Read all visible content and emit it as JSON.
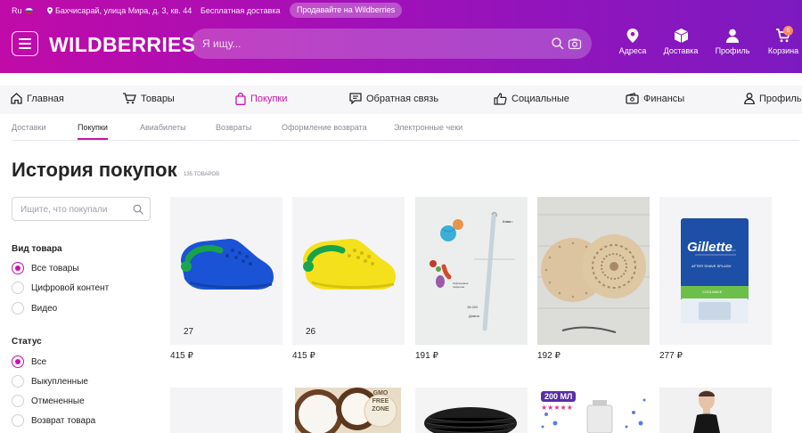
{
  "colors": {
    "brand": "#cb11ab",
    "header_start": "#c00ba8",
    "header_end": "#7c1ac0",
    "nav_bg": "#f6f6f9"
  },
  "topbar": {
    "lang": "Ru",
    "address": "Бахчисарай, улица Мира, д. 3, кв. 44",
    "free_delivery": "Бесплатная доставка",
    "sell_button": "Продавайте на Wildberries"
  },
  "header": {
    "logo": "WILDBERRIES",
    "search_placeholder": "Я ищу...",
    "nav": [
      {
        "label": "Адреса",
        "icon": "location-pin-icon"
      },
      {
        "label": "Доставка",
        "icon": "box-icon"
      },
      {
        "label": "Профиль",
        "icon": "user-icon"
      },
      {
        "label": "Корзина",
        "icon": "cart-icon",
        "badge": "6"
      }
    ]
  },
  "main_nav": [
    {
      "label": "Главная",
      "icon": "home-icon"
    },
    {
      "label": "Товары",
      "icon": "cart-icon"
    },
    {
      "label": "Покупки",
      "icon": "bag-icon",
      "active": true
    },
    {
      "label": "Обратная связь",
      "icon": "chat-icon"
    },
    {
      "label": "Социальные",
      "icon": "thumb-up-icon"
    },
    {
      "label": "Финансы",
      "icon": "wallet-icon"
    },
    {
      "label": "Профиль",
      "icon": "user-icon"
    }
  ],
  "sub_tabs": [
    {
      "label": "Доставки"
    },
    {
      "label": "Покупки",
      "active": true
    },
    {
      "label": "Авиабилеты"
    },
    {
      "label": "Возвраты"
    },
    {
      "label": "Оформление возврата"
    },
    {
      "label": "Электронные чеки"
    }
  ],
  "page": {
    "title": "История покупок",
    "count": "135 товаров"
  },
  "filters": {
    "search_placeholder": "Ищите, что покупали",
    "product_type": {
      "title": "Вид товара",
      "options": [
        "Все товары",
        "Цифровой контент",
        "Видео"
      ],
      "selected": 0
    },
    "status": {
      "title": "Статус",
      "options": [
        "Все",
        "Выкупленные",
        "Отмененные",
        "Возврат товара"
      ],
      "selected": 0
    }
  },
  "products": [
    {
      "price": "415 ₽",
      "size": "27",
      "image": "blue-crocs-clog"
    },
    {
      "price": "415 ₽",
      "size": "26",
      "image": "yellow-crocs-clog"
    },
    {
      "price": "191 ₽",
      "image": "crochet-hook-set",
      "img_labels": [
        "8 мм",
        "15 СМ",
        "Тефлоновое покрытие",
        "Длина"
      ]
    },
    {
      "price": "192 ₽",
      "image": "wooden-round-bases"
    },
    {
      "price": "277 ₽",
      "image": "gillette-aftershave-box",
      "img_labels": [
        "Gillette",
        "AFTER SHAVE SPLASH",
        "COOLWAVE"
      ]
    },
    {
      "image": "placeholder-product"
    },
    {
      "image": "coconut-product",
      "img_labels": [
        "GMO",
        "FREE",
        "ZONE"
      ]
    },
    {
      "image": "black-rattan-basket"
    },
    {
      "image": "glass-bottle-product",
      "img_labels": [
        "200 МЛ",
        "★★★★★"
      ]
    },
    {
      "image": "woman-black-dress"
    }
  ]
}
